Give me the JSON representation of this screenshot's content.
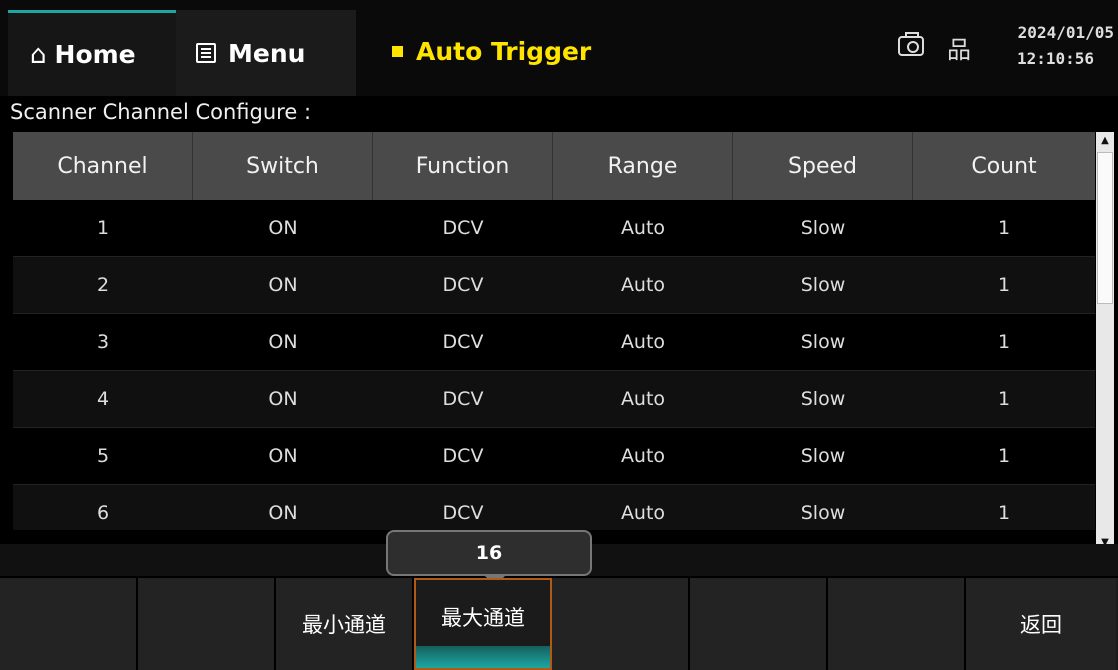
{
  "header": {
    "home_label": "Home",
    "home_icon": "home-icon",
    "menu_label": "Menu",
    "menu_icon": "menu-icon",
    "trigger_label": "Auto Trigger",
    "trigger_color": "#ffe400",
    "date": "2024/01/05",
    "time": "12:10:56"
  },
  "section": {
    "title": "Scanner Channel Configure :"
  },
  "table": {
    "columns": [
      "Channel",
      "Switch",
      "Function",
      "Range",
      "Speed",
      "Count"
    ],
    "rows": [
      [
        "1",
        "ON",
        "DCV",
        "Auto",
        "Slow",
        "1"
      ],
      [
        "2",
        "ON",
        "DCV",
        "Auto",
        "Slow",
        "1"
      ],
      [
        "3",
        "ON",
        "DCV",
        "Auto",
        "Slow",
        "1"
      ],
      [
        "4",
        "ON",
        "DCV",
        "Auto",
        "Slow",
        "1"
      ],
      [
        "5",
        "ON",
        "DCV",
        "Auto",
        "Slow",
        "1"
      ],
      [
        "6",
        "ON",
        "DCV",
        "Auto",
        "Slow",
        "1"
      ]
    ]
  },
  "value_popup": {
    "value": "16"
  },
  "softkeys": [
    "",
    "",
    "最小通道",
    "最大通道",
    "",
    "",
    "",
    "返回"
  ],
  "colors": {
    "accent": "#1fa6a2",
    "active_border": "#b25a14"
  }
}
